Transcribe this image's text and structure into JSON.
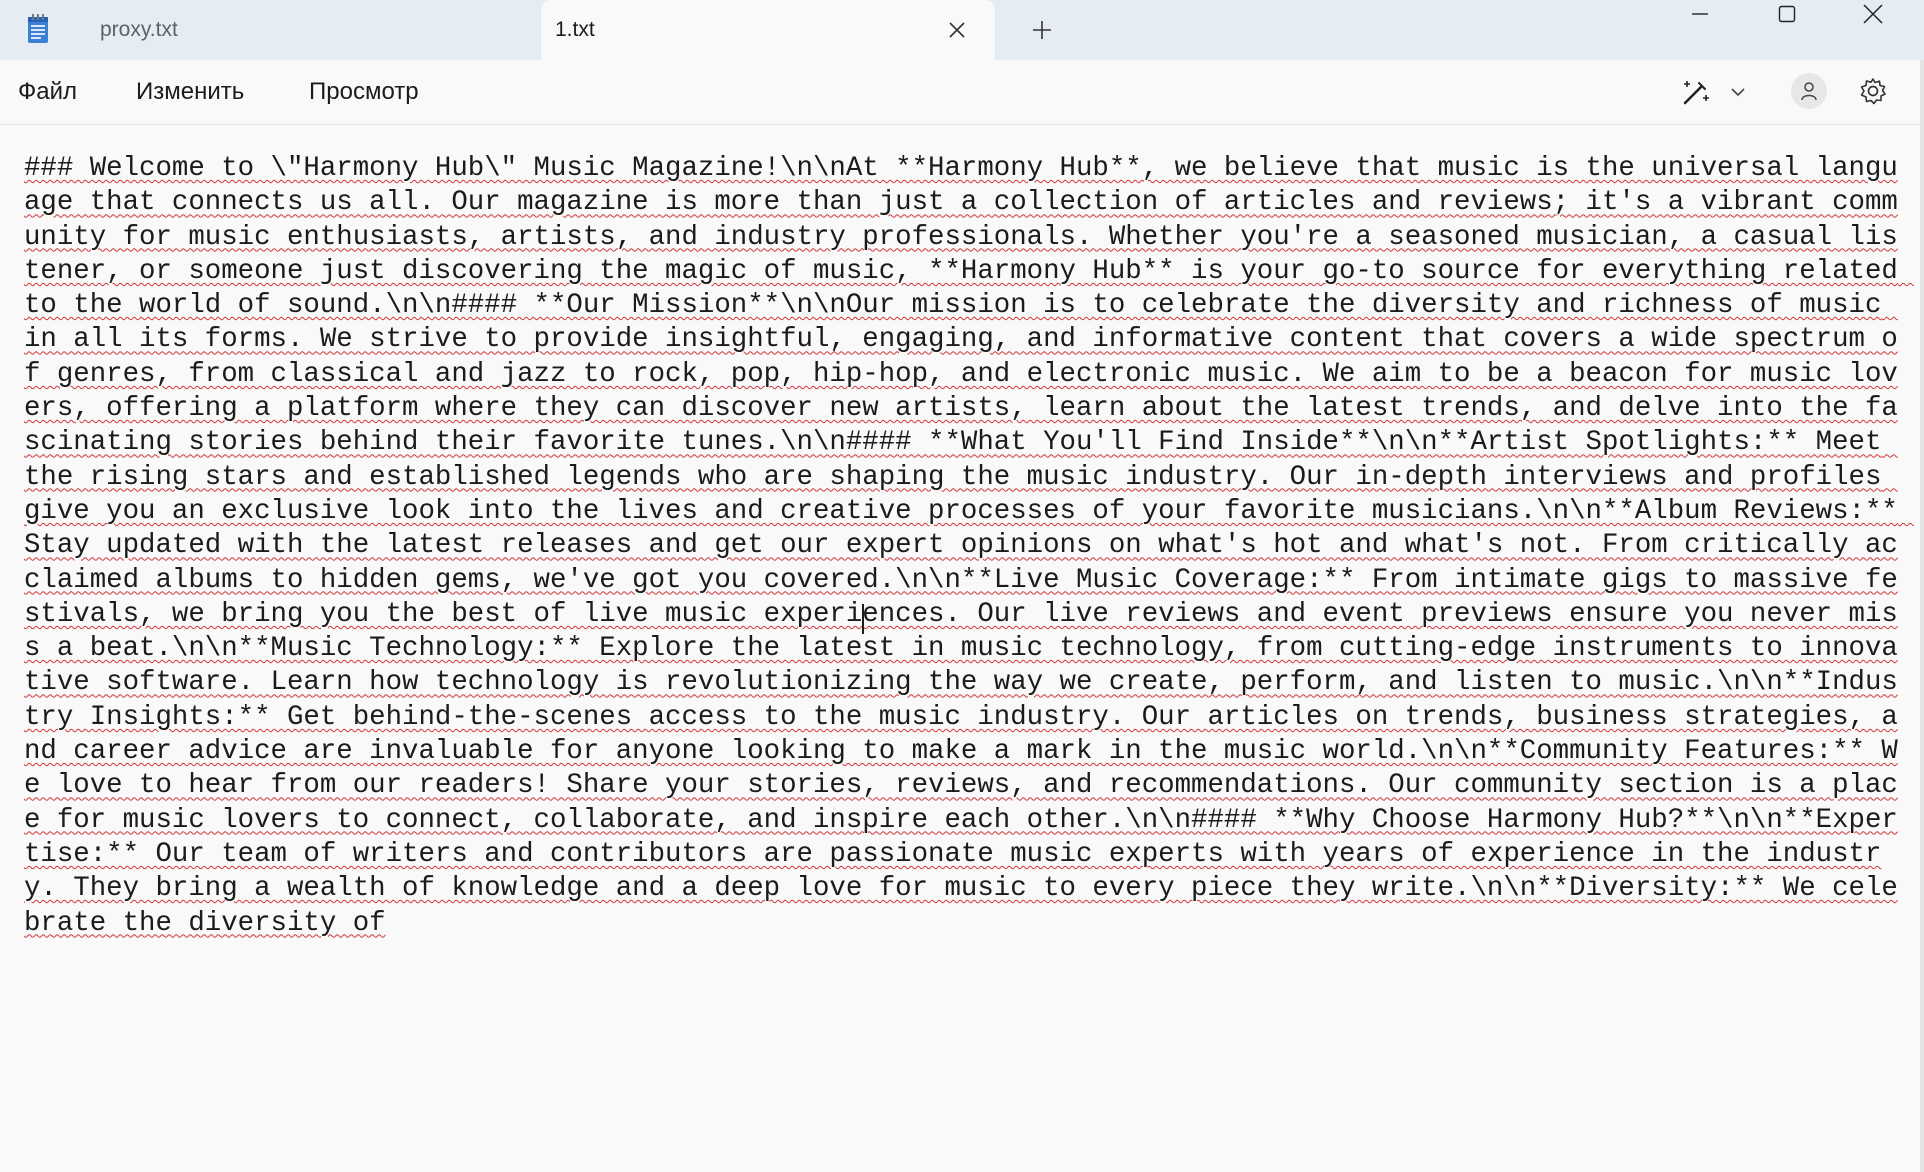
{
  "tabs": [
    {
      "label": "proxy.txt",
      "active": false
    },
    {
      "label": "1.txt",
      "active": true
    }
  ],
  "menu": {
    "file": "Файл",
    "edit": "Изменить",
    "view": "Просмотр"
  },
  "icons": {
    "app": "notepad-icon",
    "close_tab": "close-icon",
    "new_tab": "plus-icon",
    "minimize": "minimize-icon",
    "maximize": "maximize-icon",
    "close_window": "close-icon",
    "copilot": "magic-pen-icon",
    "copilot_dropdown": "chevron-down-icon",
    "account": "user-icon",
    "settings": "gear-icon"
  },
  "colors": {
    "titlebar": "#e6edf2",
    "background": "#f9f9f9",
    "spellcheck": "#d13438"
  },
  "editor": {
    "content": "### Welcome to \\\"Harmony Hub\\\" Music Magazine!\\n\\nAt **Harmony Hub**, we believe that music is the universal language that connects us all. Our magazine is more than just a collection of articles and reviews; it's a vibrant community for music enthusiasts, artists, and industry professionals. Whether you're a seasoned musician, a casual listener, or someone just discovering the magic of music, **Harmony Hub** is your go-to source for everything related to the world of sound.\\n\\n#### **Our Mission**\\n\\nOur mission is to celebrate the diversity and richness of music in all its forms. We strive to provide insightful, engaging, and informative content that covers a wide spectrum of genres, from classical and jazz to rock, pop, hip-hop, and electronic music. We aim to be a beacon for music lovers, offering a platform where they can discover new artists, learn about the latest trends, and delve into the fascinating stories behind their favorite tunes.\\n\\n#### **What You'll Find Inside**\\n\\n**Artist Spotlights:** Meet the rising stars and established legends who are shaping the music industry. Our in-depth interviews and profiles give you an exclusive look into the lives and creative processes of your favorite musicians.\\n\\n**Album Reviews:** Stay updated with the latest releases and get our expert opinions on what's hot and what's not. From critically acclaimed albums to hidden gems, we've got you covered.\\n\\n**Live Music Coverage:** From intimate gigs to massive festivals, we bring you the best of live music experiences. Our live reviews and event previews ensure you never miss a beat.\\n\\n**Music Technology:** Explore the latest in music technology, from cutting-edge instruments to innovative software. Learn how technology is revolutionizing the way we create, perform, and listen to music.\\n\\n**Industry Insights:** Get behind-the-scenes access to the music industry. Our articles on trends, business strategies, and career advice are invaluable for anyone looking to make a mark in the music world.\\n\\n**Community Features:** We love to hear from our readers! Share your stories, reviews, and recommendations. Our community section is a place for music lovers to connect, collaborate, and inspire each other.\\n\\n#### **Why Choose Harmony Hub?**\\n\\n**Expertise:** Our team of writers and contributors are passionate music experts with years of experience in the industry. They bring a wealth of knowledge and a deep love for music to every piece they write.\\n\\n**Diversity:** We celebrate the diversity of"
  }
}
